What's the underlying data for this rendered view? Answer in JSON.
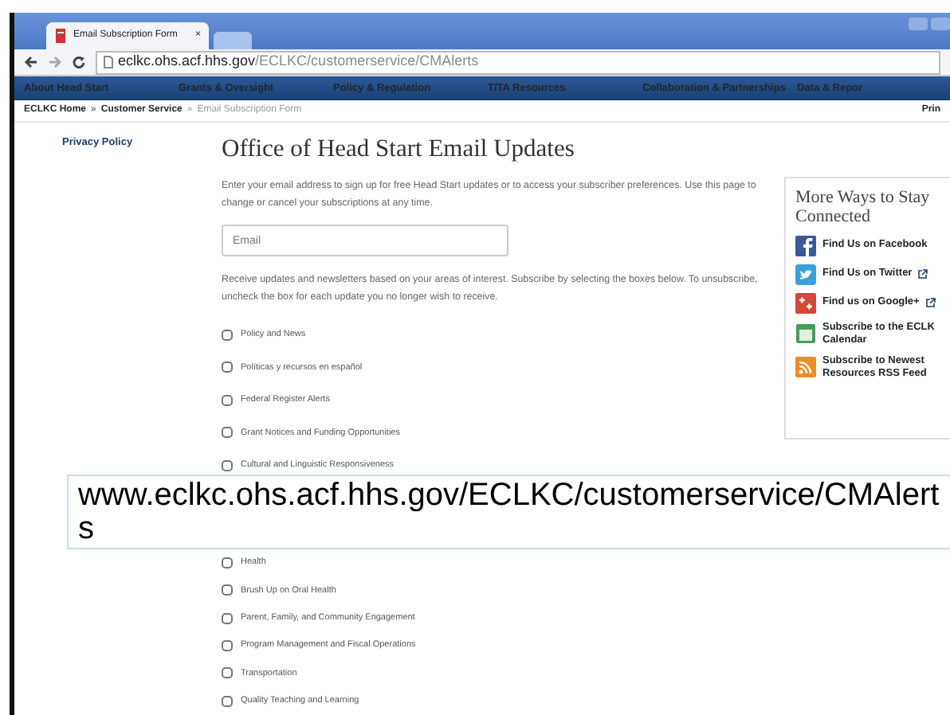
{
  "browser": {
    "tab": {
      "title": "Email Subscription Form",
      "close": "×"
    },
    "address": {
      "domain": "eclkc.ohs.acf.hhs.gov",
      "path": "/ECLKC/customerservice/CMAlerts"
    }
  },
  "nav": [
    "About Head Start",
    "Grants & Oversight",
    "Policy & Regulation",
    "T/TA Resources",
    "Collaboration & Partnerships",
    "Data & Repor"
  ],
  "breadcrumb": {
    "items": [
      {
        "label": "ECLKC Home",
        "link": true
      },
      {
        "label": "Customer Service",
        "link": true
      },
      {
        "label": "Email Subscription Form",
        "link": false
      }
    ],
    "separator": "»",
    "print": "Prin"
  },
  "sidebar": {
    "links": [
      "Privacy Policy"
    ]
  },
  "form": {
    "heading": "Office of Head Start Email Updates",
    "intro": "Enter your email address to sign up for free Head Start updates or to access your subscriber preferences. Use this page to change or cancel your subscriptions at any time.",
    "email": {
      "placeholder": "Email"
    },
    "info": "Receive updates and newsletters based on your areas of interest. Subscribe by selecting the boxes below. To unsubscribe, uncheck the box for each update you no longer wish to receive.",
    "topics_top": [
      {
        "label": "Policy and News",
        "checked": false
      },
      {
        "label": "Políticas y recursos en español",
        "checked": false
      },
      {
        "label": "Federal Register Alerts",
        "checked": false
      },
      {
        "label": "Grant Notices and Funding Opportunities",
        "checked": false
      },
      {
        "label": "Cultural and Linguistic Responsiveness",
        "checked": false
      }
    ],
    "topics_bottom": [
      {
        "label": "Health",
        "checked": false
      },
      {
        "label": "Brush Up on Oral Health",
        "checked": false
      },
      {
        "label": "Parent, Family, and Community Engagement",
        "checked": false
      },
      {
        "label": "Program Management and Fiscal Operations",
        "checked": false
      },
      {
        "label": "Transportation",
        "checked": false
      },
      {
        "label": "Quality Teaching and Learning",
        "checked": false
      }
    ]
  },
  "connect": {
    "title": "More Ways to Stay Connected",
    "links": [
      {
        "kind": "facebook",
        "label": "Find Us on Facebook",
        "external": false
      },
      {
        "kind": "twitter",
        "label": "Find Us on Twitter",
        "external": true
      },
      {
        "kind": "google",
        "label": "Find us on Google+",
        "external": true
      },
      {
        "kind": "calendar",
        "label": "Subscribe to the ECLK Calendar",
        "external": false
      },
      {
        "kind": "rss",
        "label": "Subscribe to Newest Resources RSS Feed",
        "external": false
      }
    ]
  },
  "caption": "www.eclkc.ohs.acf.hhs.gov/ECLKC/customerservice/CMAlerts"
}
